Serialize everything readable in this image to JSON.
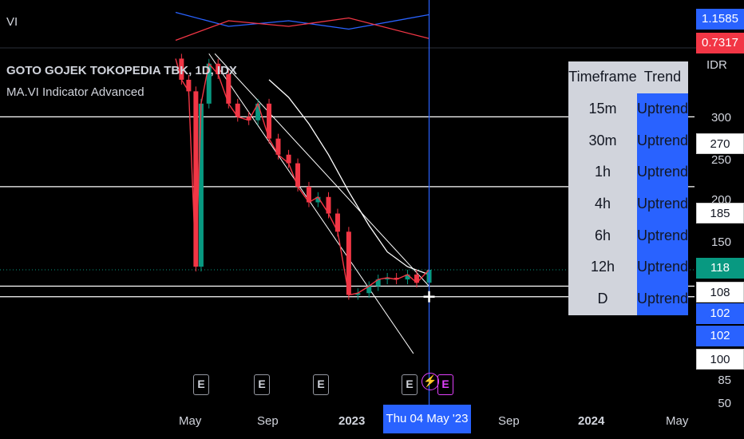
{
  "header": {
    "vi_label": "VI",
    "symbol": "GOTO GOJEK TOKOPEDIA TBK, 1D, IDX",
    "indicator": "MA.VI Indicator Advanced"
  },
  "vi_values": {
    "plus": "1.1585",
    "minus": "0.7317"
  },
  "price_axis": {
    "currency": "IDR",
    "ticks": [
      "300",
      "250",
      "200",
      "150",
      "100",
      "85",
      "50"
    ],
    "badges": [
      {
        "label": "270",
        "style": "white"
      },
      {
        "label": "185",
        "style": "white"
      },
      {
        "label": "118",
        "style": "green"
      },
      {
        "label": "108",
        "style": "white"
      },
      {
        "label": "102",
        "style": "blue"
      },
      {
        "label": "102",
        "style": "blue"
      },
      {
        "label": "100",
        "style": "white"
      }
    ]
  },
  "time_axis": {
    "ticks": [
      {
        "label": "May",
        "bold": false
      },
      {
        "label": "Sep",
        "bold": false
      },
      {
        "label": "2023",
        "bold": true
      },
      {
        "label": "Sep",
        "bold": false
      },
      {
        "label": "2024",
        "bold": true
      },
      {
        "label": "May",
        "bold": false
      }
    ],
    "crosshair_date": "Thu 04 May '23"
  },
  "trend_table": {
    "headers": [
      "Timeframe",
      "Trend"
    ],
    "rows": [
      {
        "timeframe": "15m",
        "trend": "Uptrend"
      },
      {
        "timeframe": "30m",
        "trend": "Uptrend"
      },
      {
        "timeframe": "1h",
        "trend": "Uptrend"
      },
      {
        "timeframe": "4h",
        "trend": "Uptrend"
      },
      {
        "timeframe": "6h",
        "trend": "Uptrend"
      },
      {
        "timeframe": "12h",
        "trend": "Uptrend"
      },
      {
        "timeframe": "D",
        "trend": "Uptrend"
      }
    ]
  },
  "earnings_markers": [
    "E",
    "E",
    "E",
    "E",
    "E"
  ],
  "colors": {
    "background": "#000000",
    "up_candle": "#089981",
    "down_candle": "#f23645",
    "vi_plus": "#2962ff",
    "vi_minus": "#f23645",
    "ma_line": "#ffffff",
    "crosshair": "#2962ff",
    "trend_cell": "#2962ff",
    "table_bg": "#d1d4dc"
  },
  "chart_data": {
    "type": "line",
    "title": "GOTO GOJEK TOKOPEDIA TBK, 1D, IDX",
    "y_scale": "log",
    "ylim": [
      50,
      400
    ],
    "x_range": [
      "2022-04-11",
      "2024-06-01"
    ],
    "price_close": {
      "dates": [
        "2022-04-11",
        "2022-04-20",
        "2022-05-01",
        "2022-05-12",
        "2022-05-20",
        "2022-06-01",
        "2022-06-15",
        "2022-07-01",
        "2022-07-15",
        "2022-08-01",
        "2022-08-15",
        "2022-09-01",
        "2022-09-15",
        "2022-10-01",
        "2022-10-15",
        "2022-11-01",
        "2022-11-15",
        "2022-12-01",
        "2022-12-15",
        "2023-01-01",
        "2023-01-15",
        "2023-02-01",
        "2023-02-15",
        "2023-03-01",
        "2023-03-15",
        "2023-04-01",
        "2023-04-15",
        "2023-05-04"
      ],
      "values": [
        370,
        330,
        310,
        120,
        290,
        360,
        340,
        290,
        270,
        265,
        290,
        240,
        220,
        210,
        185,
        170,
        175,
        160,
        145,
        103,
        104,
        108,
        112,
        113,
        112,
        115,
        110,
        118
      ]
    },
    "moving_average": {
      "dates": [
        "2022-09-01",
        "2022-10-01",
        "2022-11-01",
        "2022-12-01",
        "2023-01-01",
        "2023-02-01",
        "2023-03-01",
        "2023-04-01",
        "2023-05-04"
      ],
      "values": [
        330,
        300,
        260,
        220,
        180,
        150,
        130,
        120,
        115
      ]
    },
    "channel_lines": [
      {
        "from": {
          "date": "2022-06-01",
          "value": 380
        },
        "to": {
          "date": "2023-04-10",
          "value": 75
        }
      },
      {
        "from": {
          "date": "2022-06-10",
          "value": 380
        },
        "to": {
          "date": "2023-05-04",
          "value": 108
        }
      }
    ],
    "horizontal_levels": [
      270,
      185,
      108,
      102
    ],
    "vortex": {
      "dates": [
        "2022-04-11",
        "2022-07-01",
        "2022-10-01",
        "2023-01-01",
        "2023-05-04"
      ],
      "vi_plus": [
        1.2,
        0.95,
        1.05,
        0.9,
        1.1585
      ],
      "vi_minus": [
        0.7,
        1.05,
        0.95,
        1.1,
        0.7317
      ]
    },
    "earnings_dates": [
      "2022-05-15",
      "2022-08-30",
      "2022-11-25",
      "2023-04-20",
      "2023-05-10"
    ],
    "crosshair": {
      "date": "2023-05-04",
      "value": 102
    }
  }
}
